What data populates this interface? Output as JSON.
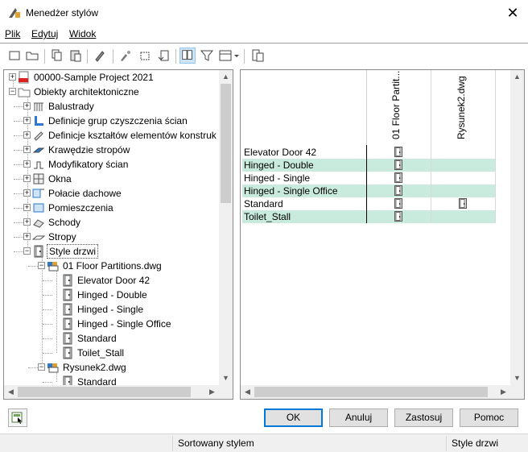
{
  "window": {
    "title": "Menedżer stylów",
    "close_glyph": "✕"
  },
  "menu": [
    {
      "label": "Plik"
    },
    {
      "label": "Edytuj"
    },
    {
      "label": "Widok"
    }
  ],
  "toolbar": {
    "icons": [
      "new-icon",
      "open-icon",
      "copy-icon",
      "paste-icon",
      "edit-style-icon",
      "purge-icon",
      "set-from-icon",
      "sync-icon",
      "toggle-view-icon",
      "filter-icon",
      "view-mode-dropdown-icon",
      "export-icon"
    ]
  },
  "tree": {
    "items": [
      {
        "label": "00000-Sample Project 2021",
        "icon": "project-pdf-icon"
      },
      {
        "label": "Obiekty architektoniczne",
        "icon": "folder-icon"
      },
      {
        "label": "Balustrady",
        "icon": "railing-icon"
      },
      {
        "label": "Definicje grup czyszczenia ścian",
        "icon": "wall-cleanup-icon"
      },
      {
        "label": "Definicje kształtów elementów konstruk",
        "icon": "member-shape-icon"
      },
      {
        "label": "Krawędzie stropów",
        "icon": "slab-edge-icon"
      },
      {
        "label": "Modyfikatory ścian",
        "icon": "wall-modifier-icon"
      },
      {
        "label": "Okna",
        "icon": "window-icon"
      },
      {
        "label": "Połacie dachowe",
        "icon": "roof-slab-icon"
      },
      {
        "label": "Pomieszczenia",
        "icon": "space-icon"
      },
      {
        "label": "Schody",
        "icon": "stair-icon"
      },
      {
        "label": "Stropy",
        "icon": "slab-icon"
      },
      {
        "label": "Style drzwi",
        "icon": "door-icon"
      },
      {
        "label": "01 Floor Partitions.dwg",
        "icon": "drawing-icon"
      },
      {
        "label": "Elevator Door 42",
        "icon": "door-icon"
      },
      {
        "label": "Hinged - Double",
        "icon": "door-icon"
      },
      {
        "label": "Hinged - Single",
        "icon": "door-icon"
      },
      {
        "label": "Hinged - Single Office",
        "icon": "door-icon"
      },
      {
        "label": "Standard",
        "icon": "door-icon"
      },
      {
        "label": "Toilet_Stall",
        "icon": "door-icon"
      },
      {
        "label": "Rysunek2.dwg",
        "icon": "drawing-icon"
      },
      {
        "label": "Standard",
        "icon": "door-icon"
      }
    ],
    "expander_plus": "+",
    "expander_minus": "−"
  },
  "grid": {
    "columns": [
      "01 Floor Partit...",
      "Rysunek2.dwg"
    ],
    "rows": [
      {
        "name": "Elevator Door 42",
        "in_col1": true,
        "in_col2": false
      },
      {
        "name": "Hinged - Double",
        "in_col1": true,
        "in_col2": false
      },
      {
        "name": "Hinged - Single",
        "in_col1": true,
        "in_col2": false
      },
      {
        "name": "Hinged - Single Office",
        "in_col1": true,
        "in_col2": false
      },
      {
        "name": "Standard",
        "in_col1": true,
        "in_col2": true
      },
      {
        "name": "Toilet_Stall",
        "in_col1": true,
        "in_col2": false
      }
    ],
    "alt_row_color": "#c8ebde"
  },
  "buttons": {
    "ok": "OK",
    "cancel": "Anuluj",
    "apply": "Zastosuj",
    "help": "Pomoc"
  },
  "status": {
    "sort": "Sortowany stylem",
    "type": "Style drzwi"
  },
  "scroll_arrows": {
    "up": "▲",
    "down": "▼",
    "left": "◀",
    "right": "▶"
  }
}
